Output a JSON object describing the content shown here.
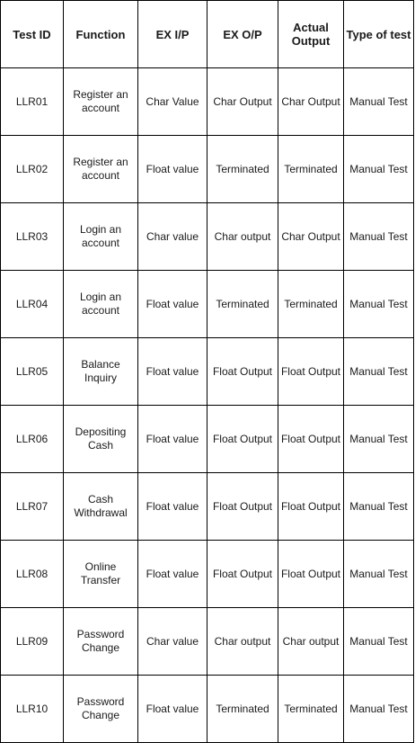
{
  "table": {
    "headers": [
      "Test ID",
      "Function",
      "EX I/P",
      "EX O/P",
      "Actual Output",
      "Type of test"
    ],
    "rows": [
      [
        "LLR01",
        "Register an account",
        "Char Value",
        "Char Output",
        "Char Output",
        "Manual Test"
      ],
      [
        "LLR02",
        "Register an account",
        "Float value",
        "Terminated",
        "Terminated",
        "Manual Test"
      ],
      [
        "LLR03",
        "Login an account",
        "Char value",
        "Char output",
        "Char Output",
        "Manual Test"
      ],
      [
        "LLR04",
        "Login an account",
        "Float value",
        "Terminated",
        "Terminated",
        "Manual Test"
      ],
      [
        "LLR05",
        "Balance Inquiry",
        "Float value",
        "Float Output",
        "Float Output",
        "Manual Test"
      ],
      [
        "LLR06",
        "Depositing Cash",
        "Float value",
        "Float Output",
        "Float Output",
        "Manual Test"
      ],
      [
        "LLR07",
        "Cash Withdrawal",
        "Float value",
        "Float Output",
        "Float Output",
        "Manual Test"
      ],
      [
        "LLR08",
        "Online Transfer",
        "Float value",
        "Float Output",
        "Float Output",
        "Manual Test"
      ],
      [
        "LLR09",
        "Password Change",
        "Char value",
        "Char output",
        "Char output",
        "Manual Test"
      ],
      [
        "LLR10",
        "Password Change",
        "Float value",
        "Terminated",
        "Terminated",
        "Manual Test"
      ]
    ]
  }
}
